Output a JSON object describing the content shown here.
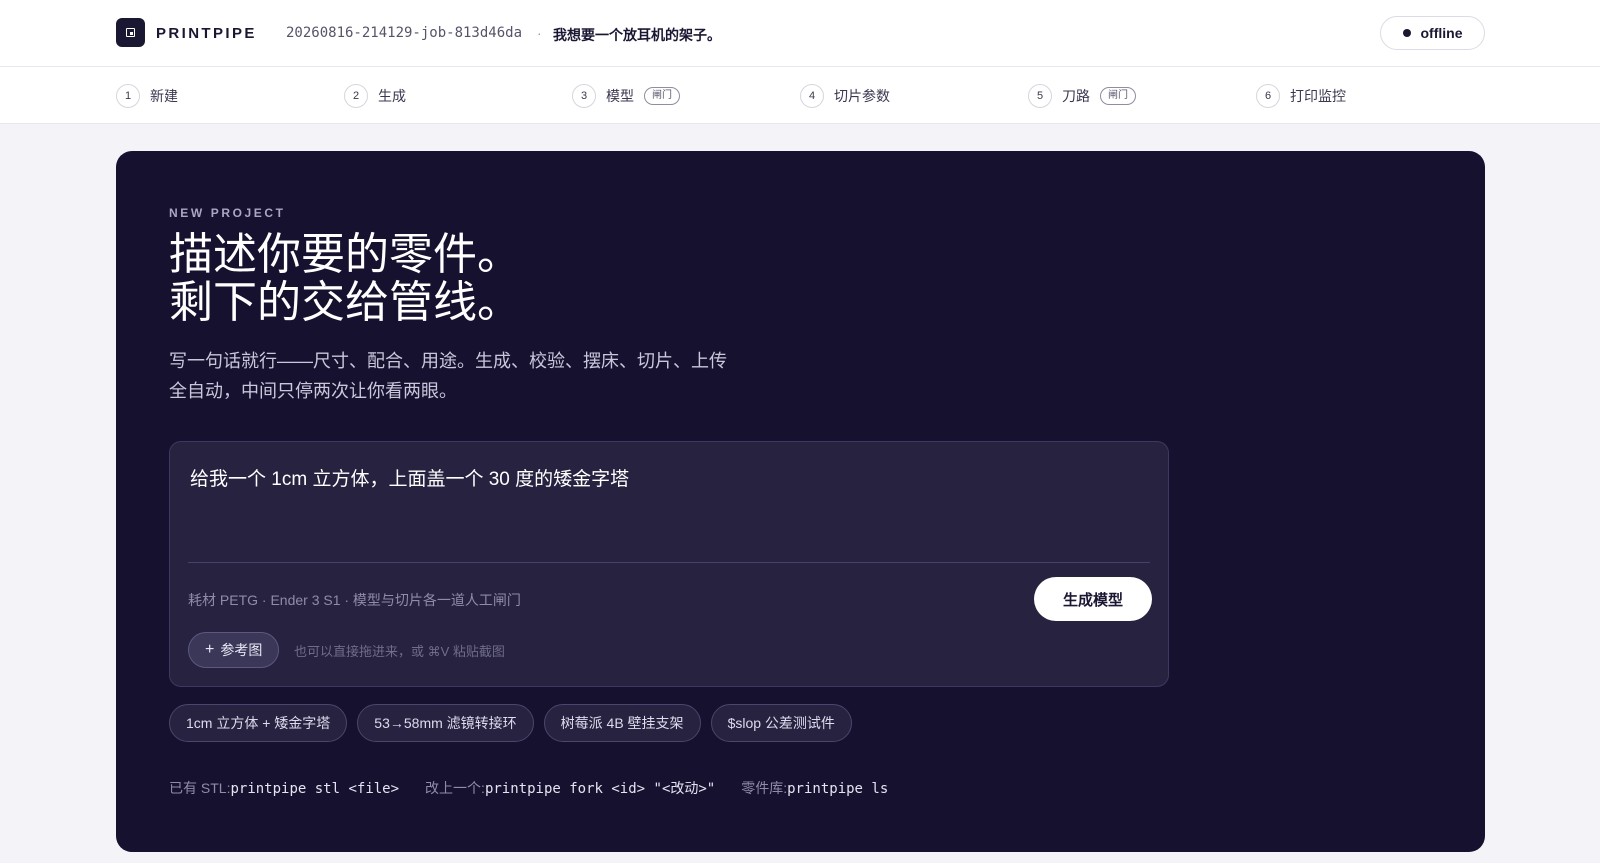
{
  "header": {
    "brand": "PRINTPIPE",
    "job_id": "20260816-214129-job-813d46da",
    "separator": "·",
    "job_title": "我想要一个放耳机的架子。",
    "status": "offline"
  },
  "steps": [
    {
      "num": "1",
      "label": "新建",
      "badge": ""
    },
    {
      "num": "2",
      "label": "生成",
      "badge": ""
    },
    {
      "num": "3",
      "label": "模型",
      "badge": "闸门"
    },
    {
      "num": "4",
      "label": "切片参数",
      "badge": ""
    },
    {
      "num": "5",
      "label": "刀路",
      "badge": "闸门"
    },
    {
      "num": "6",
      "label": "打印监控",
      "badge": ""
    }
  ],
  "hero": {
    "eyebrow": "NEW PROJECT",
    "headline_1": "描述你要的零件。",
    "headline_2": "剩下的交给管线。",
    "sub_1": "写一句话就行——尺寸、配合、用途。生成、校验、摆床、切片、上传",
    "sub_2": "全自动，中间只停两次让你看两眼。"
  },
  "prompt": {
    "value": "给我一个 1cm 立方体，上面盖一个 30 度的矮金字塔",
    "meta": "耗材 PETG · Ender 3 S1 · 模型与切片各一道人工闸门",
    "generate_label": "生成模型",
    "ref_plus": "+",
    "ref_label": "参考图",
    "ref_hint": "也可以直接拖进来，或 ⌘V 粘贴截图"
  },
  "chips": [
    "1cm 立方体 + 矮金字塔",
    "53→58mm 滤镜转接环",
    "树莓派 4B 壁挂支架",
    "$slop 公差测试件"
  ],
  "cli": {
    "stl_label": "已有 STL:",
    "stl_cmd": "printpipe stl <file>",
    "fork_label": "改上一个:",
    "fork_cmd": "printpipe fork <id> \"<改动>\"",
    "lib_label": "零件库:",
    "lib_cmd": "printpipe ls"
  }
}
